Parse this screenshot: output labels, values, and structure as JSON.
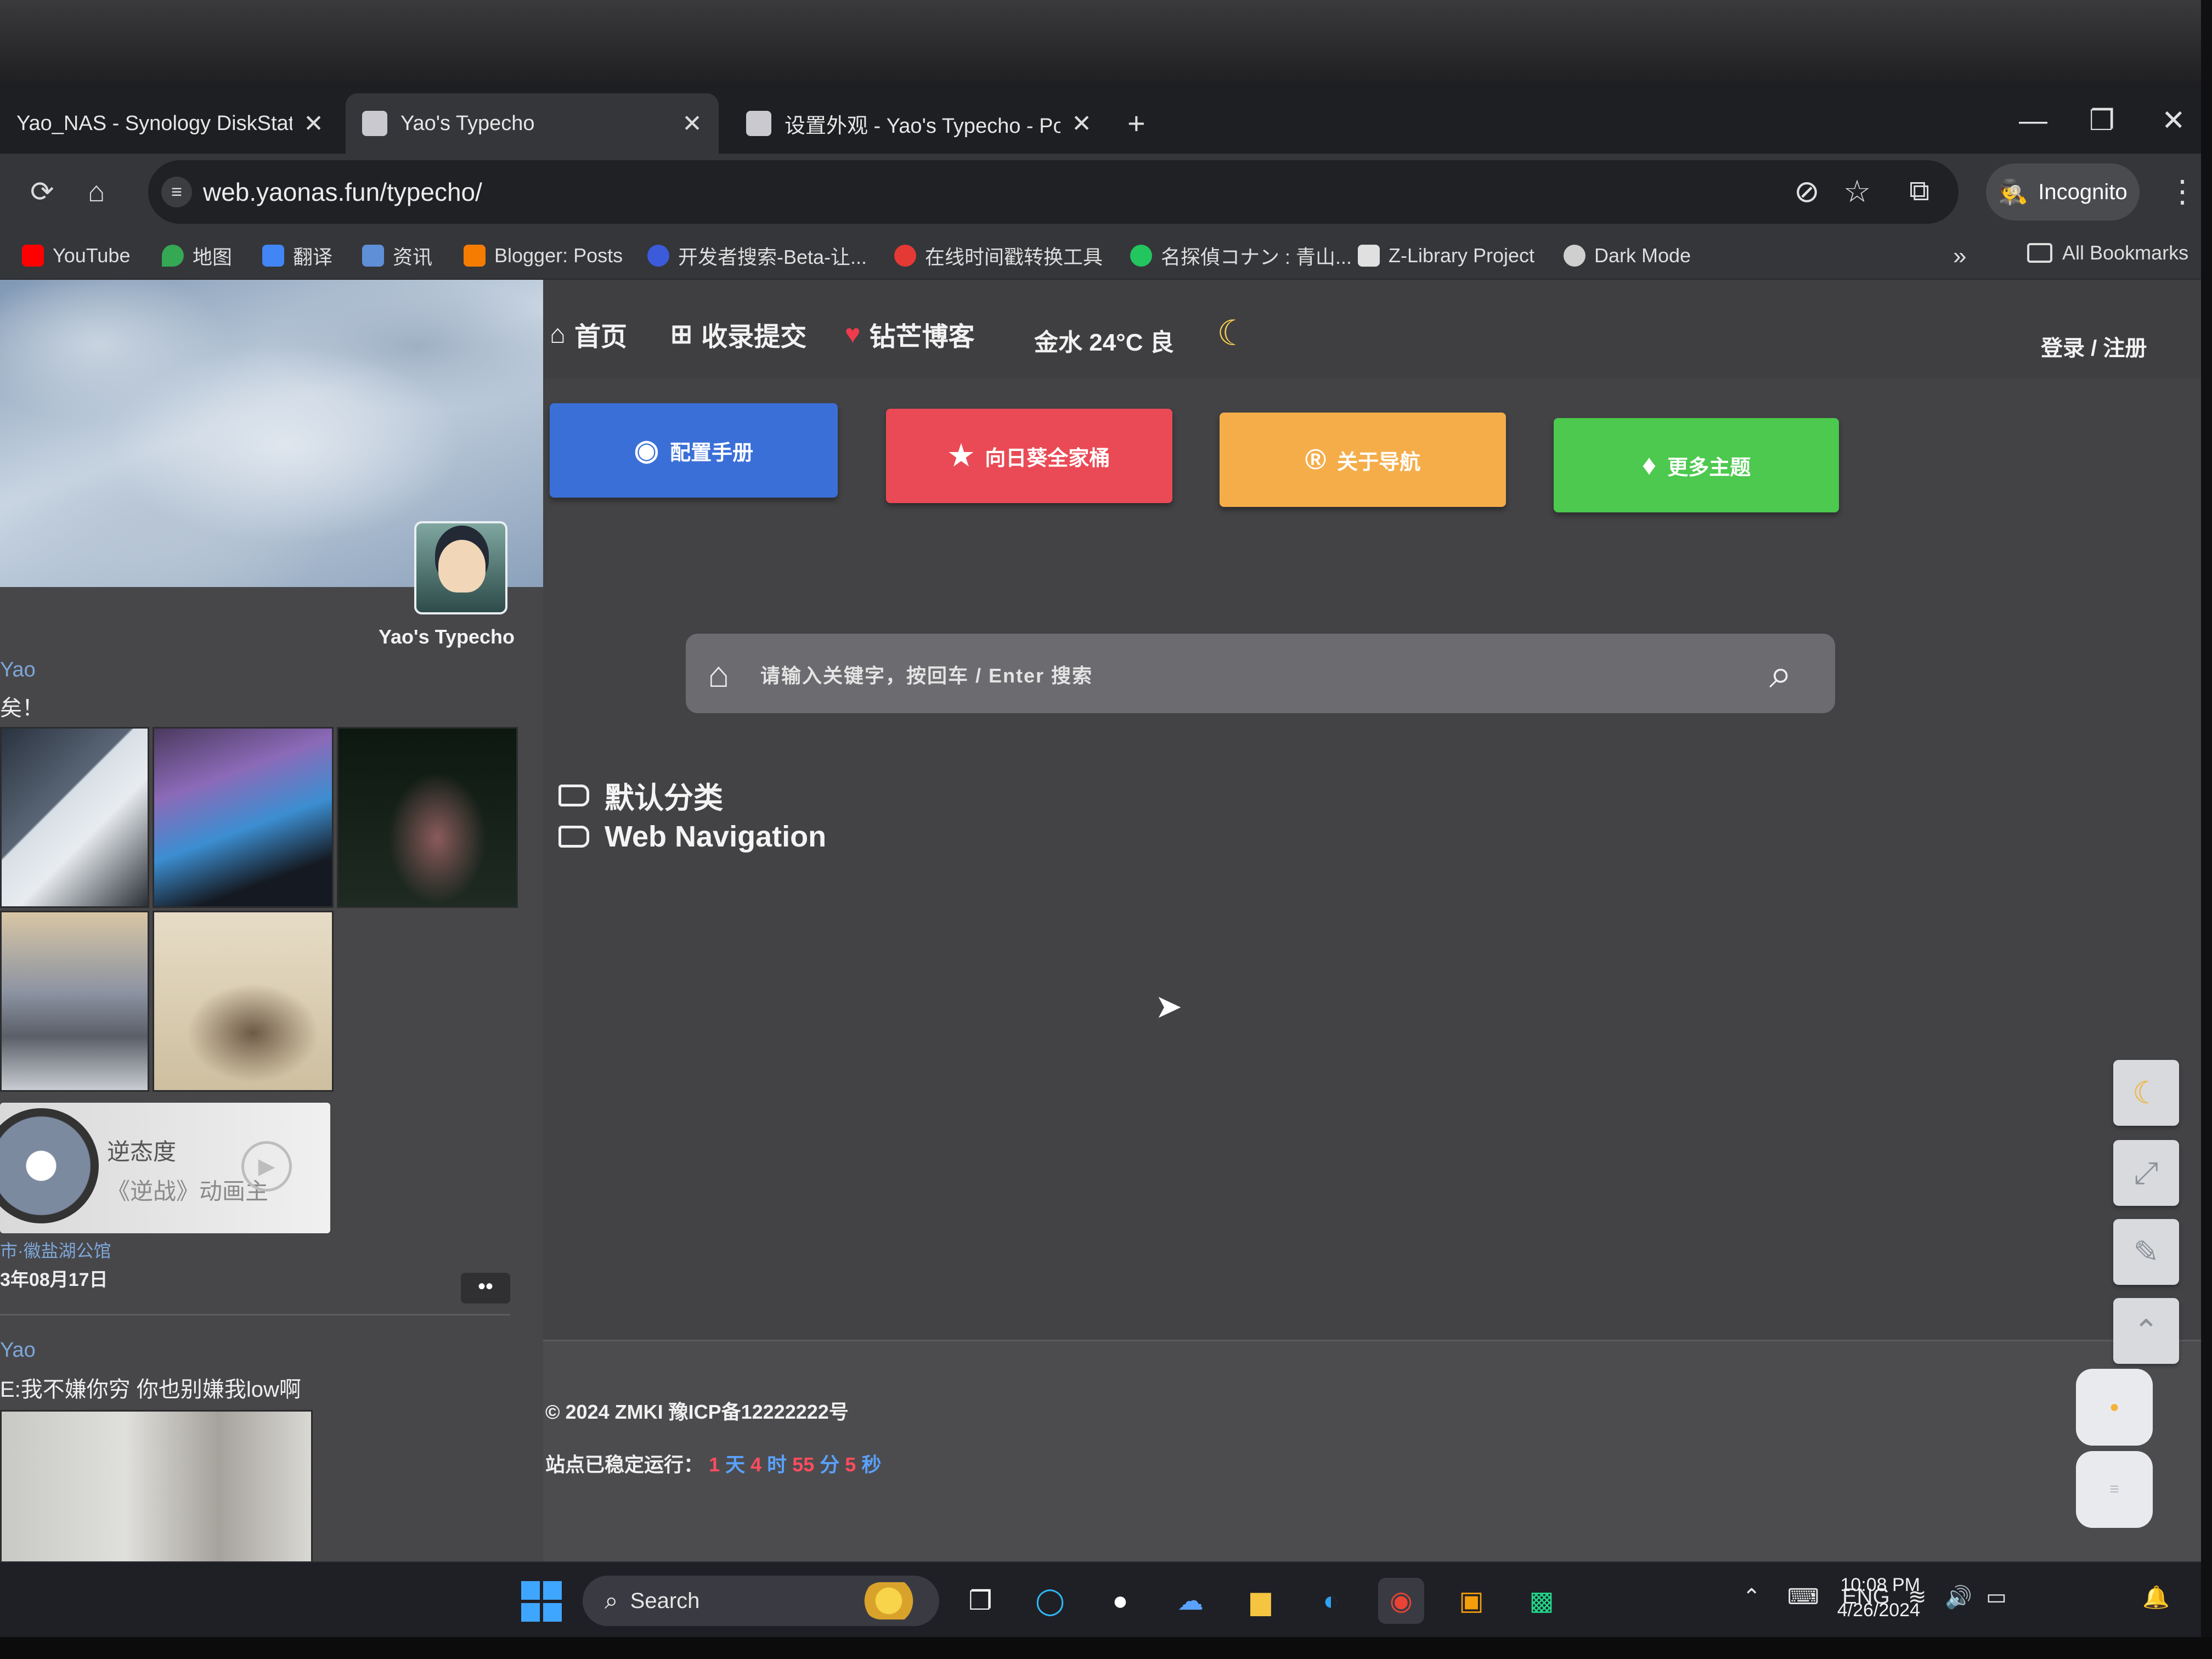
{
  "browser": {
    "tabs": [
      {
        "title": "Yao_NAS - Synology DiskStatior",
        "active": false
      },
      {
        "title": "Yao's Typecho",
        "active": true
      },
      {
        "title": "设置外观 - Yao's Typecho - Pow",
        "active": false
      }
    ],
    "new_tab_icon": "+",
    "close_icon": "✕",
    "window_controls": {
      "minimize": "—",
      "restore": "❐",
      "close": "✕"
    },
    "url": "web.yaonas.fun/typecho/",
    "incognito_label": "Incognito",
    "bookmarks": [
      {
        "label": "YouTube",
        "color": "#ff0000"
      },
      {
        "label": "地图",
        "color": "#34a853"
      },
      {
        "label": "翻译",
        "color": "#4285f4"
      },
      {
        "label": "资讯",
        "color": "#5f8fd6"
      },
      {
        "label": "Blogger: Posts",
        "color": "#f57c00"
      },
      {
        "label": "开发者搜索-Beta-让...",
        "color": "#3b5bdb"
      },
      {
        "label": "在线时间戳转换工具",
        "color": "#e53935"
      },
      {
        "label": "名探偵コナン : 青山...",
        "color": "#22c55e"
      },
      {
        "label": "Z-Library Project",
        "color": "#e0e0e0"
      },
      {
        "label": "Dark Mode",
        "color": "#cfcfcf"
      }
    ],
    "all_bookmarks_label": "All Bookmarks",
    "more_bookmarks_icon": "»"
  },
  "sidebar": {
    "blog_name": "Yao's Typecho",
    "posts": [
      {
        "author": "Yao",
        "text": "矣！",
        "music": {
          "title": "逆态度",
          "subtitle": "《逆战》动画主"
        },
        "location": "市·徽盐湖公馆",
        "date": "3年08月17日",
        "more_label": "••"
      },
      {
        "author": "Yao",
        "text": "E:我不嫌你穷 你也别嫌我low啊"
      }
    ]
  },
  "nav": {
    "items": [
      {
        "label": "首页",
        "icon": "home-icon"
      },
      {
        "label": "收录提交",
        "icon": "plus-square-icon"
      },
      {
        "label": "钻芒博客",
        "icon": "heart-icon"
      }
    ],
    "weather": "金水 24°C 良",
    "login": "登录 / 注册"
  },
  "buttons": [
    {
      "label": "配置手册",
      "icon": "compass-icon",
      "color": "#3b6fd8"
    },
    {
      "label": "向日葵全家桶",
      "icon": "star-icon",
      "color": "#ea4a55"
    },
    {
      "label": "关于导航",
      "icon": "registered-icon",
      "color": "#f5ad4a"
    },
    {
      "label": "更多主题",
      "icon": "diamond-icon",
      "color": "#4cc94e"
    }
  ],
  "search": {
    "placeholder": "请输入关键字，按回车 / Enter 搜索"
  },
  "categories": [
    "默认分类",
    "Web Navigation"
  ],
  "footer": {
    "copyright": "© 2024  ZMKI   豫ICP备12222222号",
    "uptime_label": "站点已稳定运行：",
    "uptime": {
      "days": "1",
      "days_unit": "天",
      "hours": "4",
      "hours_unit": "时",
      "minutes": "55",
      "minutes_unit": "分",
      "seconds": "5",
      "seconds_unit": "秒"
    }
  },
  "taskbar": {
    "search_label": "Search",
    "language": "ENG",
    "time": "10:08 PM",
    "date": "4/26/2024"
  }
}
